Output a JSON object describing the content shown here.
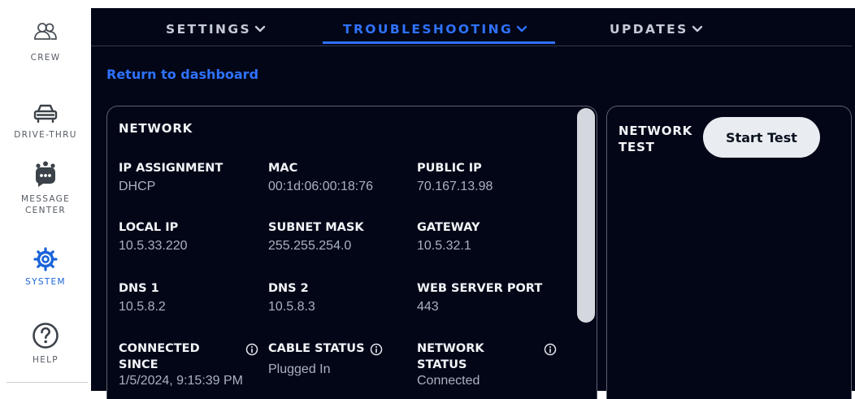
{
  "sidebar": {
    "items": [
      {
        "label": "CREW",
        "icon": "crew-icon"
      },
      {
        "label": "DRIVE-THRU",
        "icon": "car-icon"
      },
      {
        "label": "MESSAGE CENTER",
        "label_line1": "MESSAGE",
        "label_line2": "CENTER",
        "icon": "message-center-icon"
      },
      {
        "label": "SYSTEM",
        "icon": "gear-icon",
        "active": true
      },
      {
        "label": "HELP",
        "icon": "help-icon"
      }
    ]
  },
  "tabs": [
    {
      "label": "SETTINGS",
      "active": false
    },
    {
      "label": "TROUBLESHOOTING",
      "active": true
    },
    {
      "label": "UPDATES",
      "active": false
    }
  ],
  "return_link": "Return to dashboard",
  "network": {
    "title": "NETWORK",
    "fields": [
      {
        "label": "IP ASSIGNMENT",
        "value": "DHCP"
      },
      {
        "label": "MAC",
        "value": "00:1d:06:00:18:76"
      },
      {
        "label": "PUBLIC IP",
        "value": "70.167.13.98"
      },
      {
        "label": "LOCAL IP",
        "value": "10.5.33.220"
      },
      {
        "label": "SUBNET MASK",
        "value": "255.255.254.0"
      },
      {
        "label": "GATEWAY",
        "value": "10.5.32.1"
      },
      {
        "label": "DNS 1",
        "value": "10.5.8.2"
      },
      {
        "label": "DNS 2",
        "value": "10.5.8.3"
      },
      {
        "label": "WEB SERVER PORT",
        "value": "443"
      },
      {
        "label": "CONNECTED SINCE",
        "label_line1": "CONNECTED",
        "label_line2": "SINCE",
        "value": "1/5/2024, 9:15:39 PM"
      },
      {
        "label": "CABLE STATUS",
        "value": "Plugged In"
      },
      {
        "label": "NETWORK STATUS",
        "label_line1": "NETWORK",
        "label_line2": "STATUS",
        "value": "Connected"
      }
    ]
  },
  "network_test": {
    "title": "NETWORK TEST",
    "title_line1": "NETWORK",
    "title_line2": "TEST",
    "start_button": "Start Test"
  },
  "colors": {
    "accent": "#2f72ff",
    "panel_bg": "#020617",
    "sidebar_active": "#1a63d9"
  }
}
